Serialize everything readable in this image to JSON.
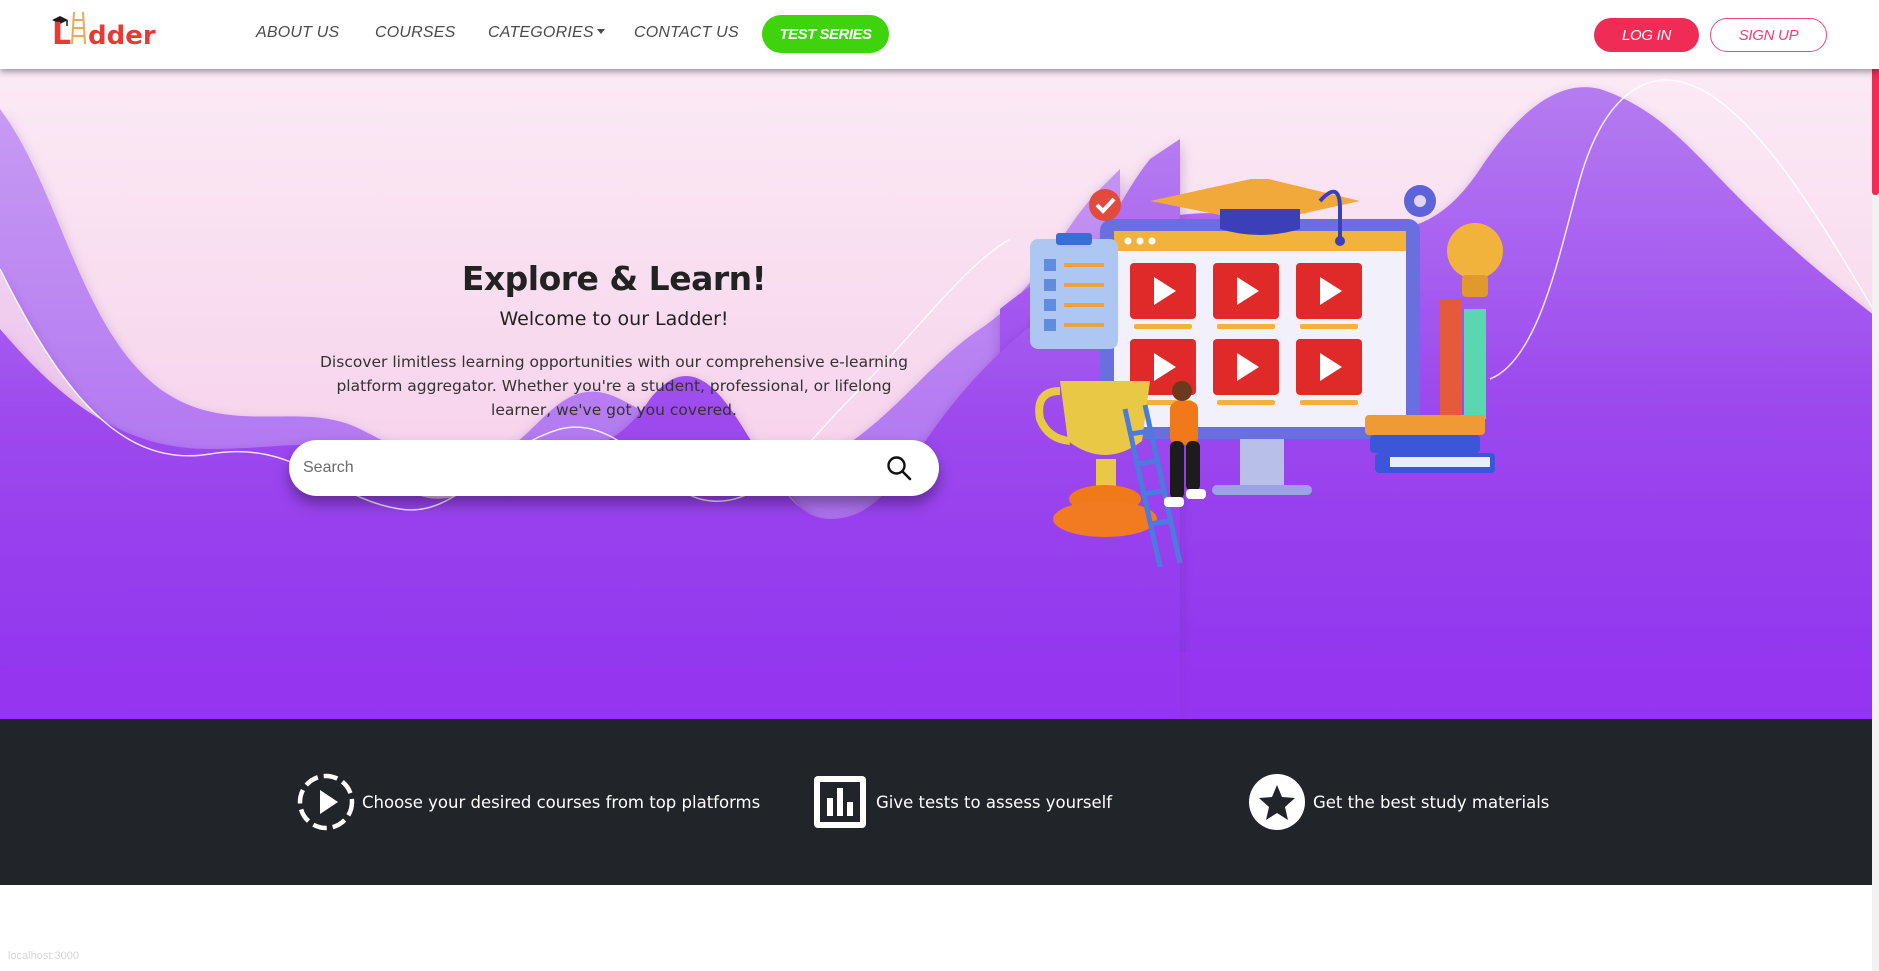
{
  "brand": {
    "name": "Ladder",
    "logo_color": "#e73a34"
  },
  "nav": {
    "about": "ABOUT US",
    "courses": "COURSES",
    "categories": "CATEGORIES",
    "contact": "CONTACT US",
    "test_series": "TEST SERIES",
    "login": "LOG IN",
    "signup": "SIGN UP"
  },
  "hero": {
    "title": "Explore & Learn!",
    "subtitle": "Welcome to our Ladder!",
    "description": "Discover limitless learning opportunities with our comprehensive e-learning platform aggregator. Whether you're a student, professional, or lifelong learner, we've got you covered.",
    "search_placeholder": "Search"
  },
  "features": [
    {
      "icon": "play-circle-icon",
      "text": "Choose your desired courses from top platforms"
    },
    {
      "icon": "bar-chart-icon",
      "text": "Give tests to assess yourself"
    },
    {
      "icon": "star-circle-icon",
      "text": "Get the best study materials"
    }
  ],
  "status_text": "localhost:3000",
  "colors": {
    "accent_green": "#3ed30c",
    "accent_pink": "#ee2c56",
    "hero_purple": "#9b3ff0",
    "dark_band": "#212529"
  }
}
